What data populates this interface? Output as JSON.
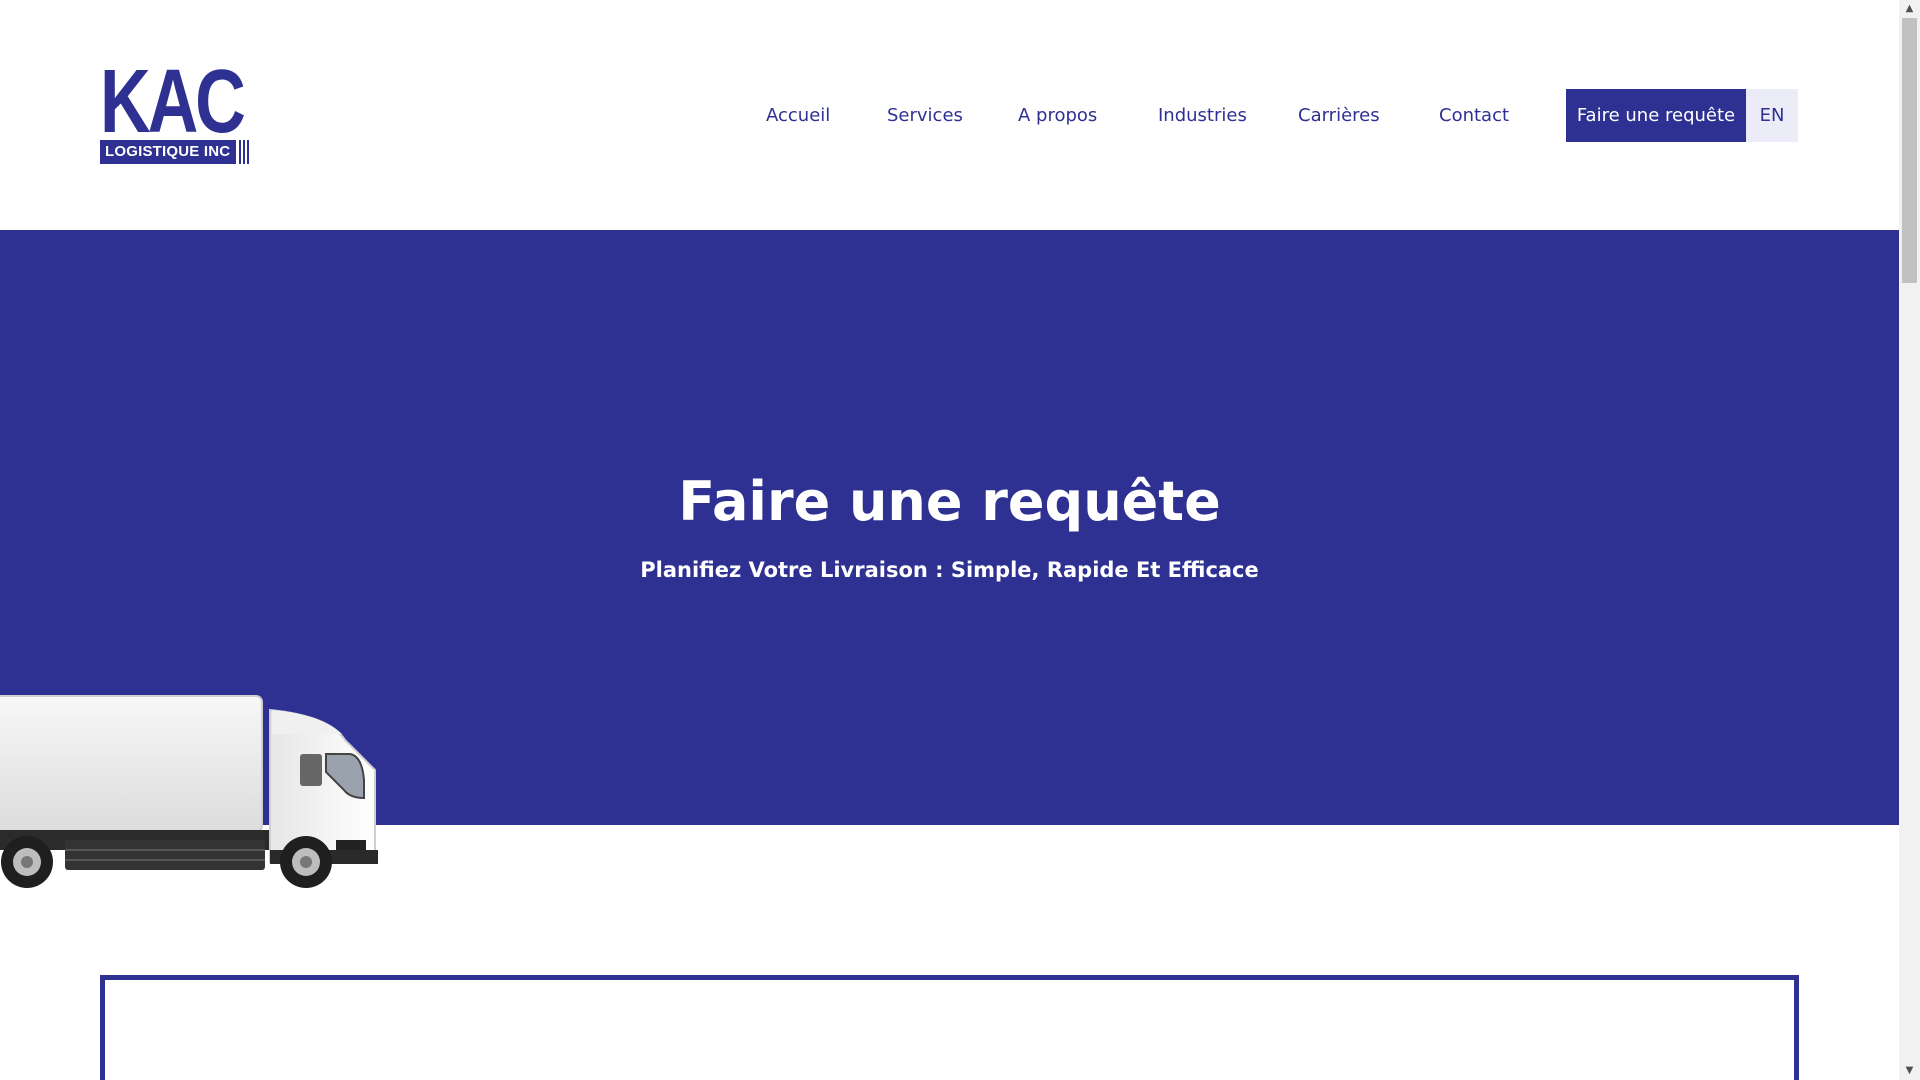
{
  "brand": {
    "logo_main": "KAC",
    "logo_sub": "LOGISTIQUE INC",
    "color_primary": "#2e3192",
    "color_lang_bg": "#ecebf8"
  },
  "nav": {
    "items": [
      {
        "label": "Accueil"
      },
      {
        "label": "Services"
      },
      {
        "label": "A propos"
      },
      {
        "label": "Industries"
      },
      {
        "label": "Carrières"
      },
      {
        "label": "Contact"
      }
    ],
    "cta_label": "Faire une requête",
    "lang_label": "EN"
  },
  "hero": {
    "title": "Faire une requête",
    "subtitle": "Planifiez Votre Livraison : Simple, Rapide Et Efficace"
  },
  "icons": {
    "scroll_up": "scroll-up-arrow-icon",
    "scroll_down": "scroll-down-arrow-icon",
    "truck": "delivery-truck-illustration"
  }
}
